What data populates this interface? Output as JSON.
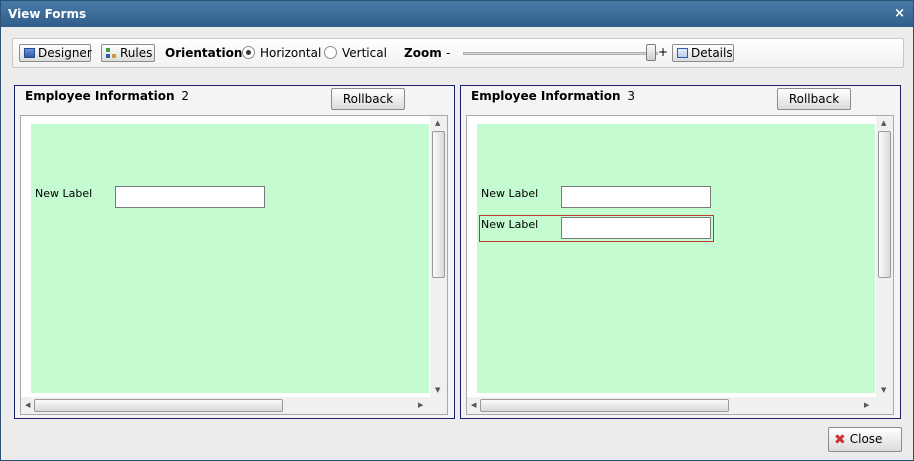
{
  "window": {
    "title": "View Forms",
    "close_glyph": "×"
  },
  "toolbar": {
    "designer_label": "Designer",
    "rules_label": "Rules",
    "orientation_label": "Orientation:",
    "horizontal_label": "Horizontal",
    "vertical_label": "Vertical",
    "orientation_selected": "Horizontal",
    "zoom_label": "Zoom",
    "zoom_minus": "-",
    "zoom_plus": "+",
    "details_label": "Details"
  },
  "panels": [
    {
      "title": "Employee Information",
      "version": "2",
      "rollback_label": "Rollback",
      "fields": [
        {
          "label": "New Label",
          "value": ""
        }
      ]
    },
    {
      "title": "Employee Information",
      "version": "3",
      "rollback_label": "Rollback",
      "fields": [
        {
          "label": "New Label",
          "value": ""
        },
        {
          "label": "New Label",
          "value": "",
          "selected": true
        }
      ]
    }
  ],
  "footer": {
    "close_label": "Close"
  },
  "colors": {
    "titlebar": "#3a6a98",
    "canvas": "#c5fbd0",
    "panel_border": "#1b1f6e",
    "selection": "#c0392b"
  }
}
